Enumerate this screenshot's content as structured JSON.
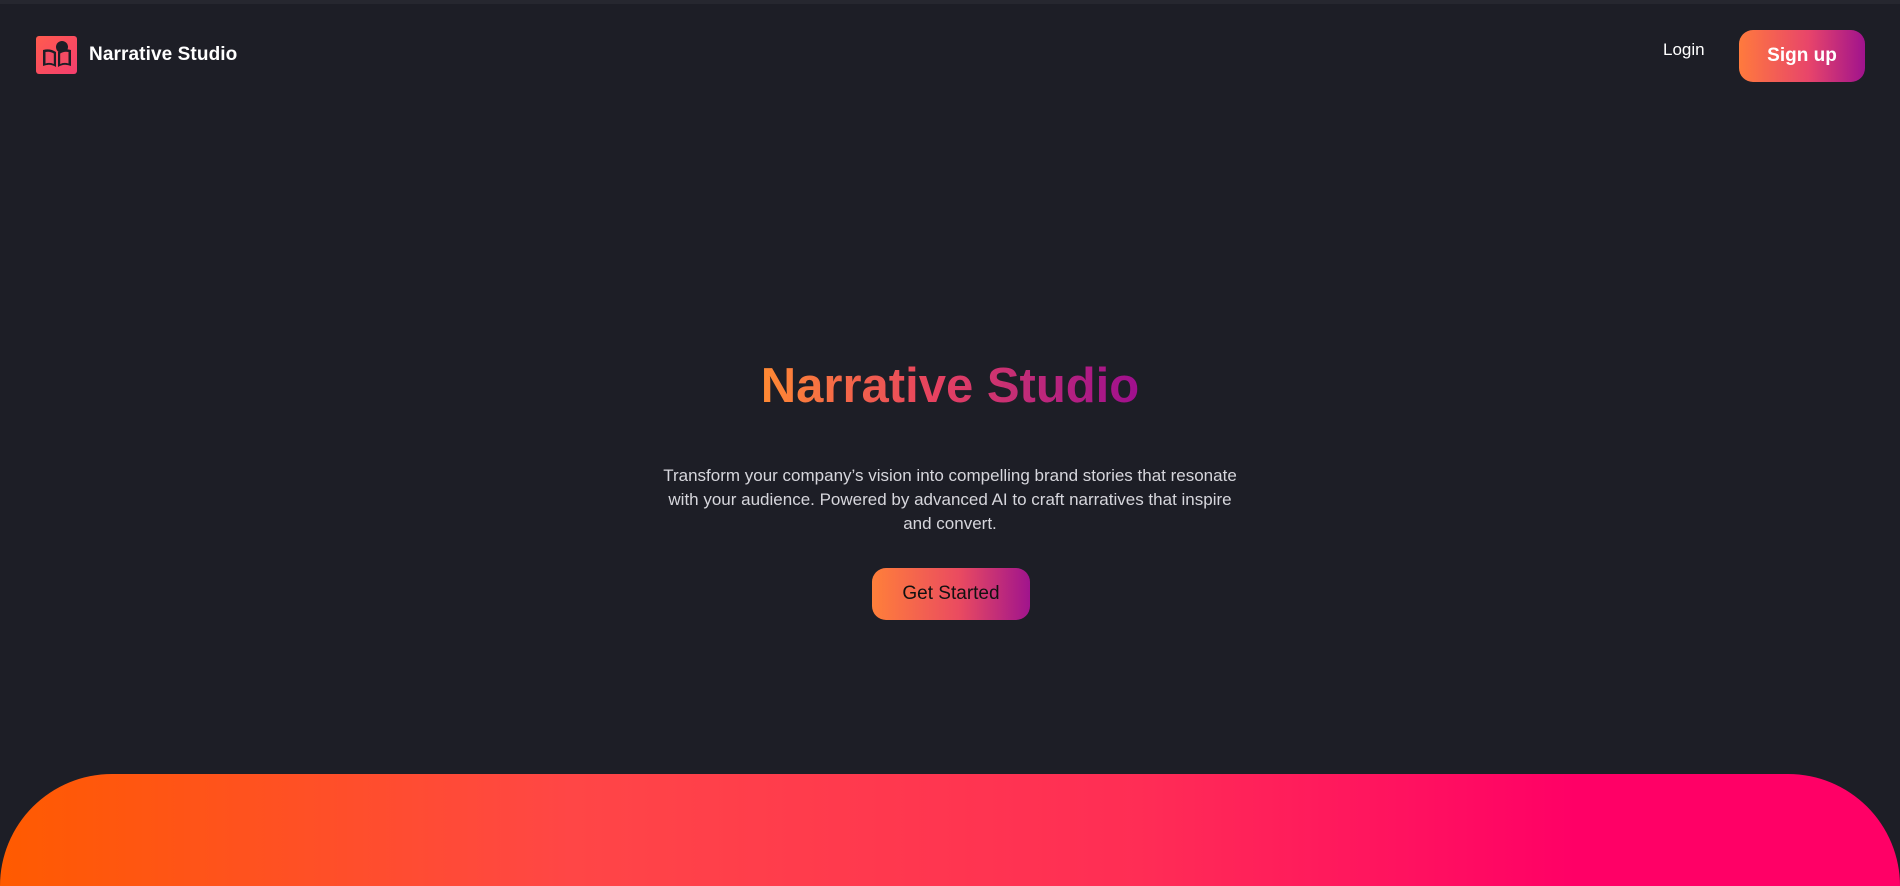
{
  "header": {
    "brand_name": "Narrative Studio",
    "login_label": "Login",
    "signup_label": "Sign up"
  },
  "hero": {
    "title": "Narrative Studio",
    "subtitle": "Transform your company’s vision into compelling brand stories that resonate with your audience. Powered by advanced AI to craft narratives that inspire and convert.",
    "cta_label": "Get Started"
  },
  "icons": {
    "logo": "book-reader-icon"
  },
  "colors": {
    "background": "#1d1e26",
    "accent_start": "#ff7a3d",
    "accent_end": "#a0138d",
    "band_start": "#ff5b00",
    "band_end": "#ff0066"
  }
}
